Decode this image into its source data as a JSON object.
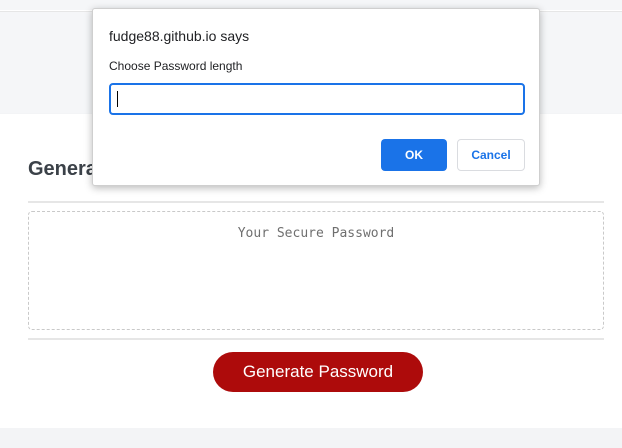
{
  "page": {
    "card_title": "Generate a Password",
    "password_placeholder": "Your Secure Password",
    "generate_label": "Generate Password"
  },
  "dialog": {
    "origin": "fudge88.github.io says",
    "message": "Choose Password length",
    "input_value": "",
    "ok_label": "OK",
    "cancel_label": "Cancel"
  },
  "colors": {
    "generate_button": "#ad0b0b",
    "dialog_accent": "#1a73e8"
  }
}
